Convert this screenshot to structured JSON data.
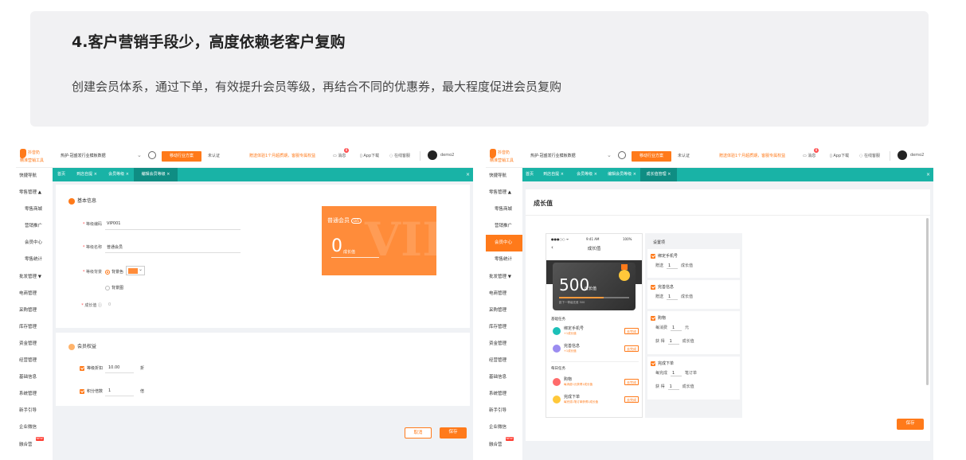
{
  "banner": {
    "title": "4.客户营销手段少，高度依赖老客户复购",
    "description": "创建会员体系，通过下单，有效提升会员等级，再结合不同的优惠券，最大程度促进会员复购"
  },
  "colors": {
    "accent": "#ff7a1a",
    "tabbar": "#19b3a6",
    "tab_active": "#0f8d83"
  },
  "header": {
    "logo_line1": "抖音奶",
    "logo_line2": "精准营销工具",
    "scope": "热护·冠盛发行业模板数据",
    "industry_button": "移动行业方案",
    "unverified": "未认证",
    "notice": "赠送体验1个月超质期，客服专属权益",
    "messages": "消息",
    "message_count": "8",
    "app_download": "App下载",
    "online_service": "在线客服",
    "user": "demo2"
  },
  "shotA": {
    "sidebar": [
      {
        "label": "快捷导航"
      },
      {
        "label": "零售管理 ▲"
      },
      {
        "label": "零售商城",
        "sub": true
      },
      {
        "label": "营销推广",
        "sub": true
      },
      {
        "label": "会员中心",
        "sub": true
      },
      {
        "label": "零售统计",
        "sub": true
      },
      {
        "label": "批发管理 ▼"
      },
      {
        "label": "电商管理"
      },
      {
        "label": "采购管理"
      },
      {
        "label": "库存管理"
      },
      {
        "label": "资金管理"
      },
      {
        "label": "经营管理"
      },
      {
        "label": "基础信息"
      },
      {
        "label": "系统管理"
      },
      {
        "label": "新手引导"
      },
      {
        "label": "企业微信"
      },
      {
        "label": "融合营",
        "new": true
      }
    ],
    "tabs": [
      "首页",
      "到店自提 ×",
      "会员等级 ×",
      "编辑会员等级 ×"
    ],
    "basic_info": {
      "title": "基本信息",
      "level_code_label": "等级编码",
      "level_code": "VIP001",
      "level_name_label": "等级名称",
      "level_name": "普通会员",
      "level_bg_label": "等级背景",
      "bg_color_option": "背景色",
      "bg_image_option": "背景图",
      "growth_label": "成长值",
      "growth_value": "0"
    },
    "vip_card": {
      "title": "普通会员",
      "level": "LV1",
      "value": "0",
      "unit": "成长值",
      "watermark": "VIP"
    },
    "benefits": {
      "title": "会员权益",
      "discount_label": "等级折扣",
      "discount_value": "10.00",
      "discount_unit": "折",
      "points_label": "积分倍数",
      "points_value": "1",
      "points_unit": "倍"
    },
    "buttons": {
      "cancel": "取消",
      "save": "保存"
    }
  },
  "shotB": {
    "sidebar": [
      {
        "label": "快捷导航"
      },
      {
        "label": "零售管理 ▲"
      },
      {
        "label": "零售商城",
        "sub": true
      },
      {
        "label": "营销推广",
        "sub": true
      },
      {
        "label": "会员中心",
        "sub": true,
        "active": true
      },
      {
        "label": "零售统计",
        "sub": true
      },
      {
        "label": "批发管理 ▼"
      },
      {
        "label": "电商管理"
      },
      {
        "label": "采购管理"
      },
      {
        "label": "库存管理"
      },
      {
        "label": "资金管理"
      },
      {
        "label": "经营管理"
      },
      {
        "label": "基础信息"
      },
      {
        "label": "系统管理"
      },
      {
        "label": "新手引导"
      },
      {
        "label": "企业微信"
      },
      {
        "label": "融合营",
        "new": true
      }
    ],
    "tabs": [
      "首页",
      "到店自提 ×",
      "会员等级 ×",
      "编辑会员等级 ×",
      "成长值管理 ×"
    ],
    "page_title": "成长值",
    "phone": {
      "status_left": "●●●○○ ᯤ",
      "time": "9:41 AM",
      "battery": "100%",
      "title": "成长值",
      "value": "500",
      "unit": "成长值",
      "desc": "距下一等级还差 500",
      "basic_tasks": "基础任务",
      "daily_tasks": "每日任务",
      "tasks": [
        {
          "name": "绑定手机号",
          "sub": "+1成长值",
          "btn": "去完成",
          "color": "#1cc0b8"
        },
        {
          "name": "完善信息",
          "sub": "+1成长值",
          "btn": "去完成",
          "color": "#9b8cf0"
        },
        {
          "name": "购物",
          "sub": "每消费1元获得1成长值",
          "btn": "去完成",
          "color": "#ff6b6b"
        },
        {
          "name": "完成下单",
          "sub": "每完成1笔订单获得1成长值",
          "btn": "去完成",
          "color": "#ffc83a"
        }
      ]
    },
    "rules": {
      "header": "设置项",
      "items": [
        {
          "title": "绑定手机号",
          "lines": [
            [
              "赠送",
              "1",
              "成长值"
            ]
          ]
        },
        {
          "title": "完善信息",
          "lines": [
            [
              "赠送",
              "1",
              "成长值"
            ]
          ]
        },
        {
          "title": "购物",
          "lines": [
            [
              "每消费",
              "1",
              "元"
            ],
            [
              "获 得",
              "1",
              "成长值"
            ]
          ]
        },
        {
          "title": "完成下单",
          "lines": [
            [
              "每完成",
              "1",
              "笔订单"
            ],
            [
              "获 得",
              "1",
              "成长值"
            ]
          ]
        }
      ]
    },
    "buttons": {
      "save": "保存"
    }
  }
}
